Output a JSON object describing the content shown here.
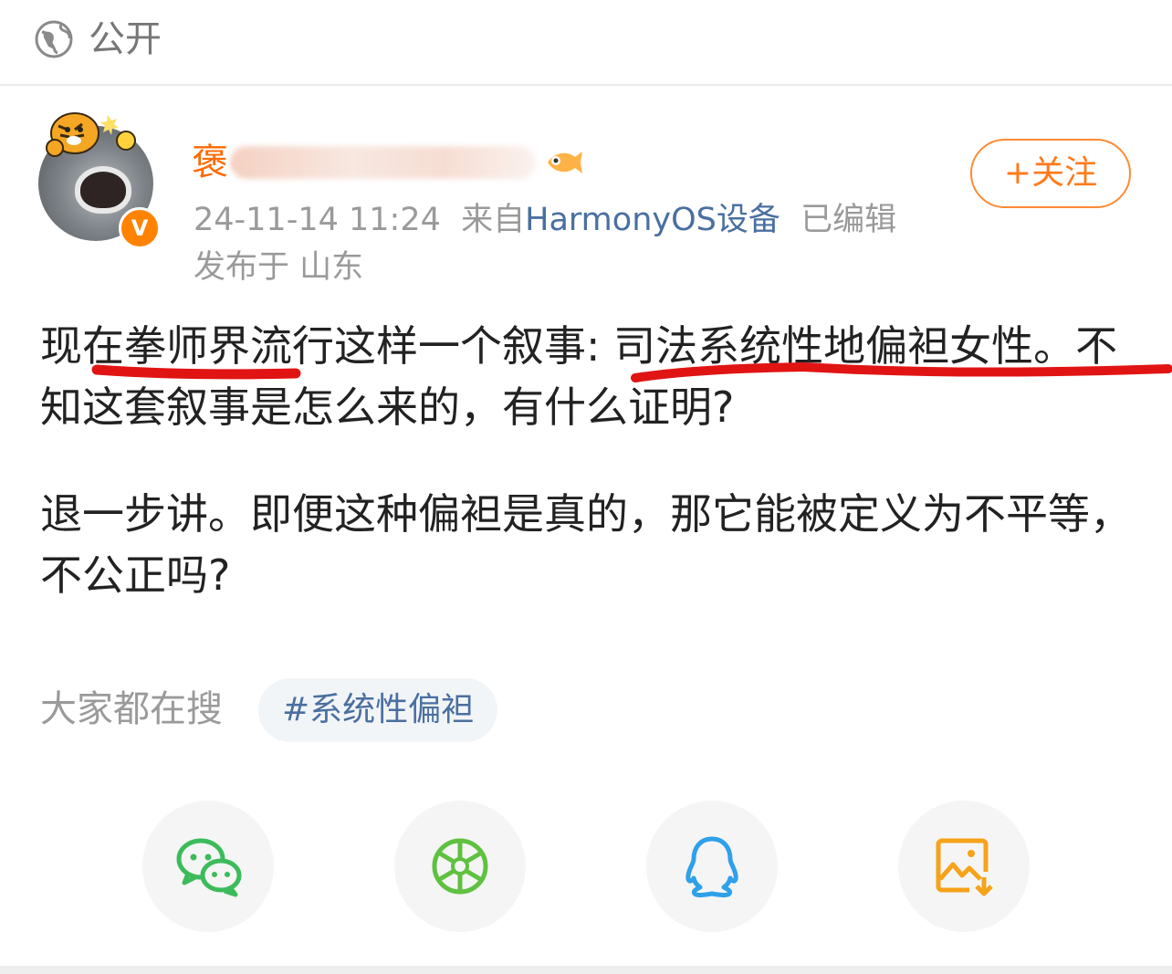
{
  "visibility": {
    "label": "公开",
    "icon": "globe-icon"
  },
  "post": {
    "author": {
      "name_visible": "褒",
      "verified_icon": "verified-v-icon",
      "verified_glyph": "V"
    },
    "follow_button": {
      "label": "+关注"
    },
    "timestamp": "24-11-14 11:24",
    "source_prefix": "来自",
    "source": "HarmonyOS设备",
    "edited": "已编辑",
    "location": "发布于 山东",
    "paragraphs": [
      "现在拳师界流行这样一个叙事: 司法系统性地偏袒女性。不知这套叙事是怎么来的，有什么证明?",
      "退一步讲。即便这种偏袒是真的，那它能被定义为不平等，不公正吗?"
    ]
  },
  "trending": {
    "label": "大家都在搜",
    "tag": "#系统性偏袒"
  },
  "share": [
    {
      "name": "wechat",
      "icon": "wechat-icon",
      "color": "#3dbb5b"
    },
    {
      "name": "moments",
      "icon": "moments-icon",
      "color": "#5fc140"
    },
    {
      "name": "qq",
      "icon": "qq-icon",
      "color": "#2fa0ea"
    },
    {
      "name": "save-image",
      "icon": "save-image-icon",
      "color": "#f5a31a"
    }
  ],
  "colors": {
    "accent": "#ff8200",
    "link": "#4a6fa0",
    "annotation": "#e11414"
  }
}
